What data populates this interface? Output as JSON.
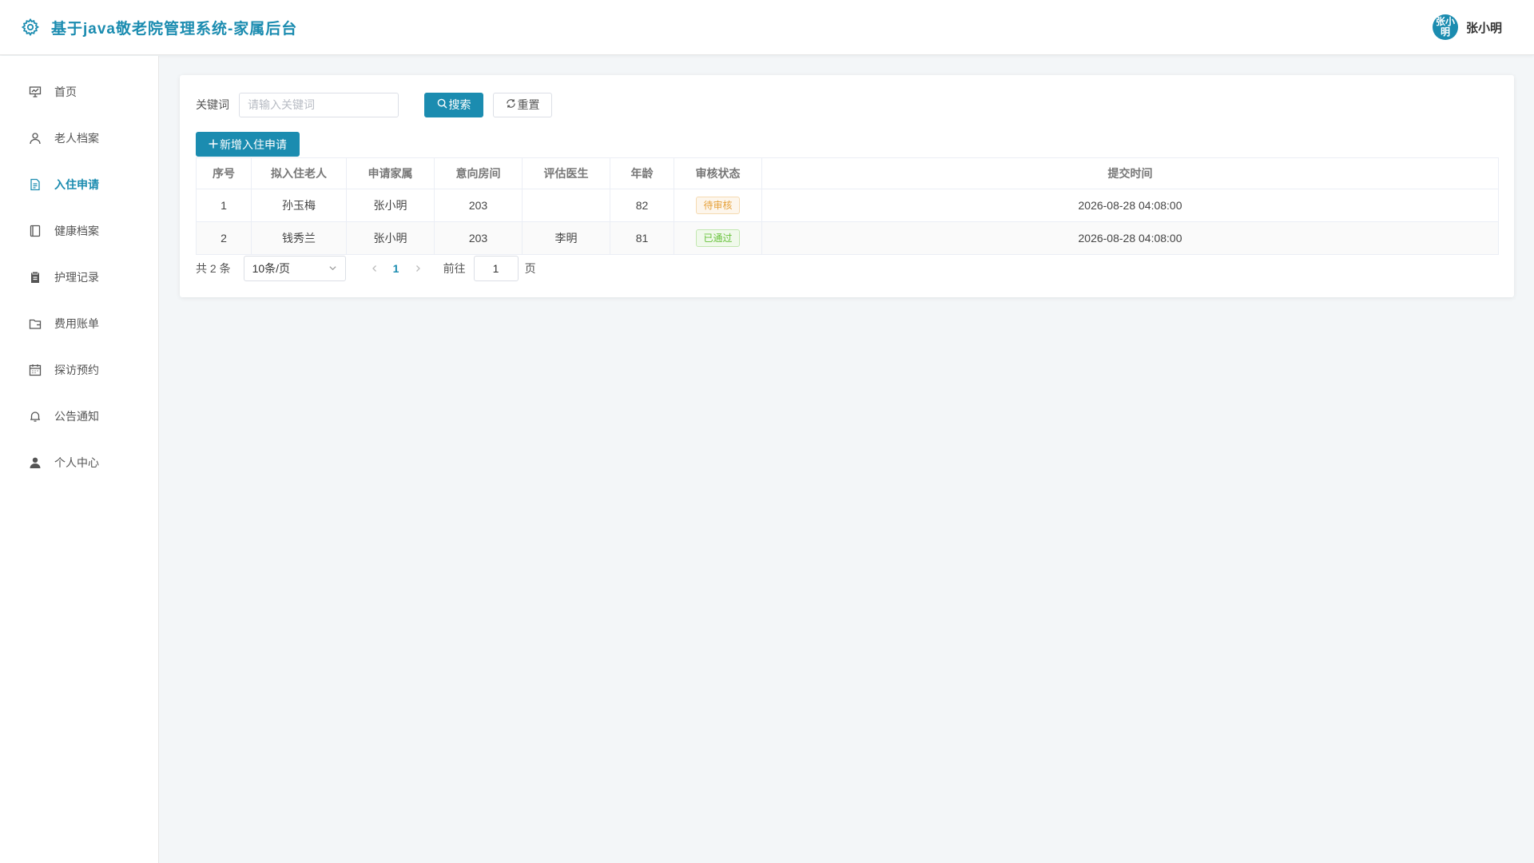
{
  "header": {
    "title": "基于java敬老院管理系统-家属后台",
    "avatar_text": "张小明",
    "username": "张小明"
  },
  "colors": {
    "accent": "#1b8cb0",
    "warning": "#e6a23c",
    "success": "#67c23a"
  },
  "sidebar": {
    "items": [
      {
        "label": "首页",
        "icon": "presentation-chart-icon",
        "active": false
      },
      {
        "label": "老人档案",
        "icon": "user-icon",
        "active": false
      },
      {
        "label": "入住申请",
        "icon": "document-icon",
        "active": true
      },
      {
        "label": "健康档案",
        "icon": "notebook-icon",
        "active": false
      },
      {
        "label": "护理记录",
        "icon": "clipboard-icon",
        "active": false
      },
      {
        "label": "费用账单",
        "icon": "wallet-icon",
        "active": false
      },
      {
        "label": "探访预约",
        "icon": "calendar-icon",
        "active": false
      },
      {
        "label": "公告通知",
        "icon": "bell-icon",
        "active": false
      },
      {
        "label": "个人中心",
        "icon": "user-filled-icon",
        "active": false
      }
    ]
  },
  "filter": {
    "label": "关键词",
    "placeholder": "请输入关键词",
    "value": "",
    "search_label": "搜索",
    "reset_label": "重置",
    "add_label": "新增入住申请"
  },
  "table": {
    "columns": [
      "序号",
      "拟入住老人",
      "申请家属",
      "意向房间",
      "评估医生",
      "年龄",
      "审核状态",
      "提交时间"
    ],
    "rows": [
      {
        "index": "1",
        "elder": "孙玉梅",
        "family": "张小明",
        "room": "203",
        "doctor": "",
        "age": "82",
        "status": "待审核",
        "status_type": "warning",
        "submitted": "2026-08-28 04:08:00"
      },
      {
        "index": "2",
        "elder": "钱秀兰",
        "family": "张小明",
        "room": "203",
        "doctor": "李明",
        "age": "81",
        "status": "已通过",
        "status_type": "success",
        "submitted": "2026-08-28 04:08:00"
      }
    ]
  },
  "pagination": {
    "total_text": "共 2 条",
    "page_size": "10条/页",
    "current_page": "1",
    "goto_label": "前往",
    "goto_value": "1",
    "goto_suffix": "页"
  }
}
